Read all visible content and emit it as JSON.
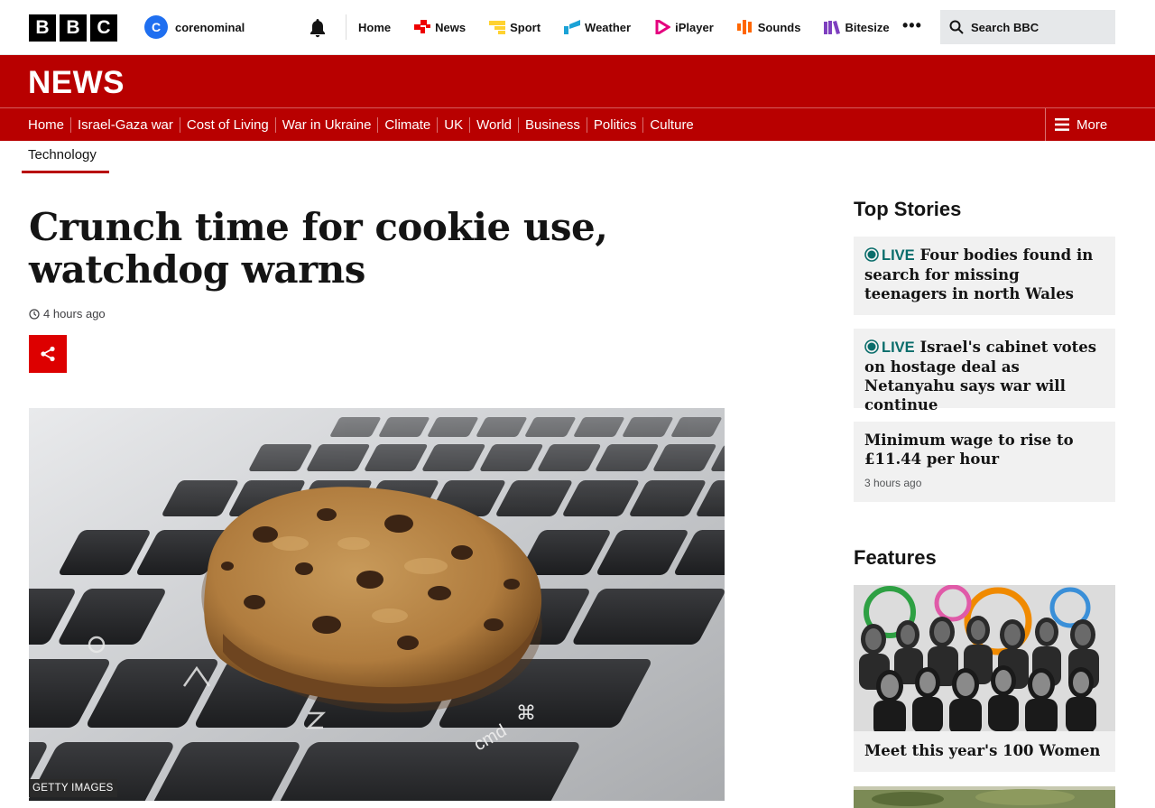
{
  "brand": {
    "letters": [
      "B",
      "B",
      "C"
    ]
  },
  "account": {
    "initial": "C",
    "name": "corenominal"
  },
  "top_nav": [
    {
      "label": "Home",
      "icon": "none"
    },
    {
      "label": "News",
      "icon": "news-icon",
      "color": "#e00"
    },
    {
      "label": "Sport",
      "icon": "sport-icon",
      "color": "#ffd230"
    },
    {
      "label": "Weather",
      "icon": "weather-icon",
      "color": "#1ba2d6"
    },
    {
      "label": "iPlayer",
      "icon": "iplayer-icon",
      "color": "#e4007e"
    },
    {
      "label": "Sounds",
      "icon": "sounds-icon",
      "color": "#ff6600"
    },
    {
      "label": "Bitesize",
      "icon": "bitesize-icon",
      "color": "#7e3fbf"
    }
  ],
  "search": {
    "placeholder": "Search BBC"
  },
  "news": {
    "logo": "NEWS",
    "subnav": [
      "Home",
      "Israel-Gaza war",
      "Cost of Living",
      "War in Ukraine",
      "Climate",
      "UK",
      "World",
      "Business",
      "Politics",
      "Culture"
    ],
    "more_label": "More",
    "section": "Technology"
  },
  "article": {
    "headline": "Crunch time for cookie use, watchdog warns",
    "timestamp": "4 hours ago",
    "image_credit": "GETTY IMAGES"
  },
  "sidebar": {
    "top_stories_heading": "Top Stories",
    "stories": [
      {
        "live": "LIVE",
        "title": "Four bodies found in search for missing teenagers in north Wales"
      },
      {
        "live": "LIVE",
        "title": "Israel's cabinet votes on hostage deal as Netanyahu says war will continue"
      },
      {
        "live": "",
        "title": "Minimum wage to rise to £11.44 per hour",
        "ago": "3 hours ago"
      }
    ],
    "features_heading": "Features",
    "feature_title": "Meet this year's 100 Women"
  },
  "colors": {
    "news_red": "#b80000",
    "share_red": "#dd0000",
    "live_teal": "#0a6d6b"
  }
}
